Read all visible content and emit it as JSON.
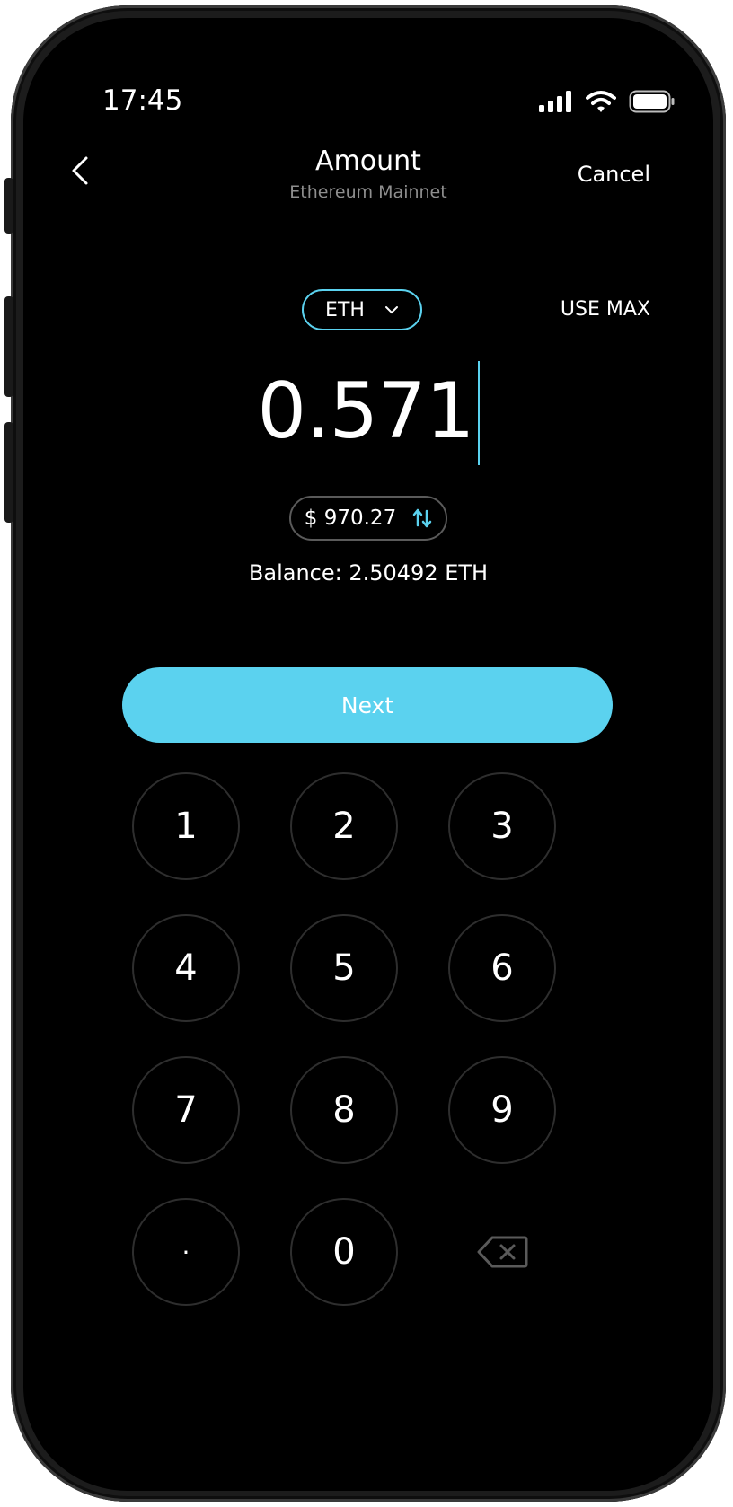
{
  "status_bar": {
    "time": "17:45",
    "icons": [
      "signal-icon",
      "wifi-icon",
      "battery-icon"
    ]
  },
  "header": {
    "title": "Amount",
    "subtitle": "Ethereum Mainnet",
    "cancel_label": "Cancel"
  },
  "token": {
    "symbol": "ETH",
    "use_max_label": "USE MAX"
  },
  "amount": {
    "value": "0.571"
  },
  "fiat": {
    "value": "$ 970.27"
  },
  "balance": {
    "text": "Balance: 2.50492 ETH"
  },
  "next_label": "Next",
  "keypad": {
    "keys": [
      "1",
      "2",
      "3",
      "4",
      "5",
      "6",
      "7",
      "8",
      "9",
      "·",
      "0"
    ]
  },
  "colors": {
    "accent": "#5bd2ef",
    "background": "#000000",
    "muted": "#8e8e8e"
  }
}
